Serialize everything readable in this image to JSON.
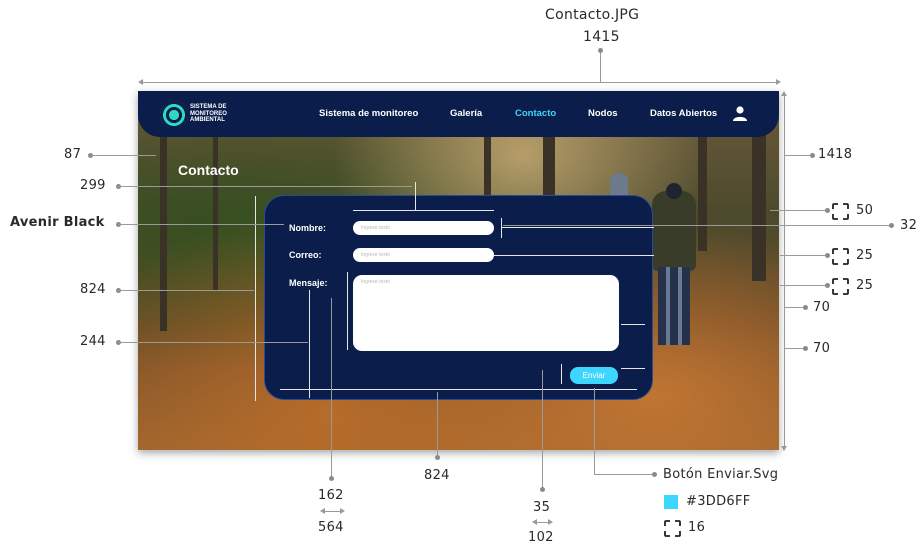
{
  "file_title": "Contacto.JPG",
  "annotations": {
    "overall_width": "1415",
    "overall_height": "1418",
    "left_margin": "87",
    "title_offset": "299",
    "font_note": "Avenir Black",
    "form_height": "824",
    "form_left_offset": "244",
    "form_width": "824",
    "input_spacing_top": "50",
    "input_height": "32",
    "field_gap_1": "25",
    "field_gap_2": "25",
    "inner_padding_1": "70",
    "inner_padding_2": "70",
    "label_offset_top": "162",
    "label_offset_bottom": "564",
    "button_height": "35",
    "button_width": "102",
    "button_file": "Botón Enviar.Svg",
    "button_color": "#3DD6FF",
    "button_radius": "16"
  },
  "navbar": {
    "logo_text": [
      "SISTEMA DE",
      "MONITOREO",
      "AMBIENTAL"
    ],
    "items": [
      {
        "label": "Sistema de monitoreo",
        "active": false
      },
      {
        "label": "Galería",
        "active": false
      },
      {
        "label": "Contacto",
        "active": true
      },
      {
        "label": "Nodos",
        "active": false
      },
      {
        "label": "Datos Abiertos",
        "active": false
      }
    ]
  },
  "page": {
    "title": "Contacto"
  },
  "form": {
    "name_label": "Nombre:",
    "email_label": "Correo:",
    "message_label": "Mensaje:",
    "name_placeholder": "Ingrese texto",
    "email_placeholder": "Ingrese texto",
    "message_placeholder": "Ingrese texto",
    "submit_label": "Enviar"
  },
  "colors": {
    "navy": "#0b1d4a",
    "accent": "#3DD6FF"
  }
}
